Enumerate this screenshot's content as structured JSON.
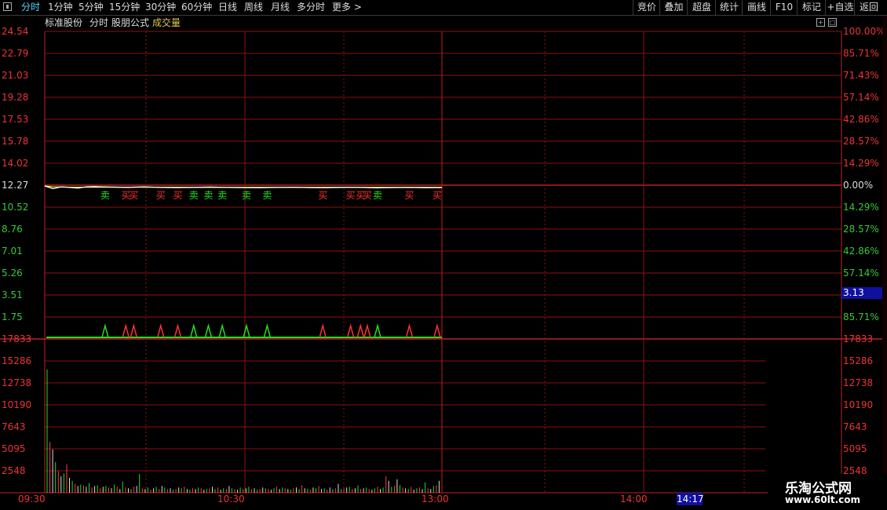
{
  "toolbar": {
    "tabs": [
      "分时",
      "1分钟",
      "5分钟",
      "15分钟",
      "30分钟",
      "60分钟",
      "日线",
      "周线",
      "月线",
      "多分时",
      "更多 >"
    ],
    "active_tab": "分时",
    "right_buttons": [
      "竞价",
      "叠加",
      "超盘",
      "统计",
      "画线",
      "F10",
      "标记",
      "+自选",
      "返回"
    ]
  },
  "title": {
    "stock": "标准股份",
    "period": "分时",
    "formula": "股朋公式",
    "volume_label": "成交量"
  },
  "price_axis": {
    "left_labels": [
      "24.54",
      "22.79",
      "21.03",
      "19.28",
      "17.53",
      "15.78",
      "14.02",
      "12.27",
      "10.52",
      "8.76",
      "7.01",
      "5.26",
      "3.51",
      "1.75"
    ],
    "right_labels": [
      "100.00%",
      "85.71%",
      "71.43%",
      "57.14%",
      "42.86%",
      "28.57%",
      "14.29%",
      "0.00%",
      "14.29%",
      "28.57%",
      "42.86%",
      "57.14%",
      "",
      "85.71%"
    ]
  },
  "volume_axis": {
    "left_labels": [
      "17833",
      "15286",
      "12738",
      "10190",
      "7643",
      "5095",
      "2548"
    ],
    "right_labels": [
      "17833",
      "15286",
      "12738",
      "10190",
      "7643",
      "5095",
      "2548"
    ]
  },
  "time_axis": [
    "09:30",
    "10:30",
    "13:00",
    "14:00"
  ],
  "cursor_price": "3.13",
  "cursor_time": "14:17",
  "signal_labels": {
    "buy": "买",
    "sell": "卖"
  },
  "signals": [
    {
      "pos": 0.152,
      "type": "sell"
    },
    {
      "pos": 0.204,
      "type": "buy"
    },
    {
      "pos": 0.224,
      "type": "buy"
    },
    {
      "pos": 0.292,
      "type": "buy"
    },
    {
      "pos": 0.335,
      "type": "buy"
    },
    {
      "pos": 0.375,
      "type": "sell"
    },
    {
      "pos": 0.412,
      "type": "sell"
    },
    {
      "pos": 0.447,
      "type": "sell"
    },
    {
      "pos": 0.508,
      "type": "sell"
    },
    {
      "pos": 0.56,
      "type": "sell"
    },
    {
      "pos": 0.7,
      "type": "buy"
    },
    {
      "pos": 0.77,
      "type": "buy"
    },
    {
      "pos": 0.795,
      "type": "buy"
    },
    {
      "pos": 0.812,
      "type": "buy"
    },
    {
      "pos": 0.838,
      "type": "sell"
    },
    {
      "pos": 0.918,
      "type": "buy"
    },
    {
      "pos": 0.988,
      "type": "buy"
    }
  ],
  "chart_data": {
    "type": "line",
    "title": "",
    "prev_close": 12.27,
    "ylim": [
      0,
      24.54
    ],
    "x": [
      0,
      5,
      10,
      15,
      20,
      25,
      30,
      40,
      50,
      60,
      70,
      80,
      90,
      100,
      110,
      120,
      130,
      140,
      150,
      160,
      170,
      180,
      190,
      200,
      210,
      220,
      230,
      240
    ],
    "price": [
      12.27,
      12.05,
      12.2,
      12.15,
      12.1,
      12.2,
      12.22,
      12.18,
      12.16,
      12.2,
      12.15,
      12.14,
      12.16,
      12.18,
      12.15,
      12.14,
      12.13,
      12.15,
      12.17,
      12.14,
      12.13,
      12.16,
      12.15,
      12.12,
      12.14,
      12.15,
      12.13,
      12.14
    ],
    "avg_price": [
      12.27,
      12.2,
      12.18,
      12.17,
      12.17,
      12.17,
      12.17,
      12.17,
      12.17,
      12.17,
      12.17,
      12.17,
      12.16,
      12.16,
      12.16,
      12.16,
      12.16,
      12.16,
      12.16,
      12.16,
      12.16,
      12.16,
      12.16,
      12.16,
      12.16,
      12.16,
      12.16,
      12.16
    ],
    "volume_ylim": [
      0,
      20380
    ],
    "volume": [
      16500,
      6800,
      5800,
      4100,
      2900,
      2200,
      2600,
      3800,
      2000,
      1600,
      1200,
      900,
      1100,
      1000,
      800,
      1300,
      700,
      900,
      1000,
      600,
      800,
      900,
      700,
      600,
      1100,
      800,
      500,
      1500,
      700,
      600,
      500,
      800,
      900,
      2500,
      600,
      500,
      700,
      400,
      600,
      800,
      500,
      900,
      700,
      500,
      600,
      400,
      500,
      700,
      600,
      800,
      500,
      400,
      600,
      500,
      700,
      600,
      400,
      500,
      600,
      800,
      500,
      700,
      400,
      600,
      500,
      900,
      600,
      500,
      400,
      700,
      500,
      600,
      800,
      500,
      600,
      400,
      500,
      700,
      600,
      500,
      400,
      600,
      800,
      500,
      700,
      600,
      500,
      400,
      600,
      700,
      500,
      1000,
      600,
      500,
      400,
      700,
      600,
      900,
      500,
      600,
      400,
      700,
      500,
      600,
      1200,
      500,
      600,
      700,
      800,
      500,
      600,
      1000,
      500,
      600,
      700,
      500,
      400,
      600,
      800,
      500,
      700,
      2200,
      1600,
      800,
      900,
      1800,
      1000,
      700,
      600,
      500,
      800,
      400,
      600,
      700,
      500,
      1400,
      600,
      500,
      900,
      1000,
      1600
    ]
  }
}
